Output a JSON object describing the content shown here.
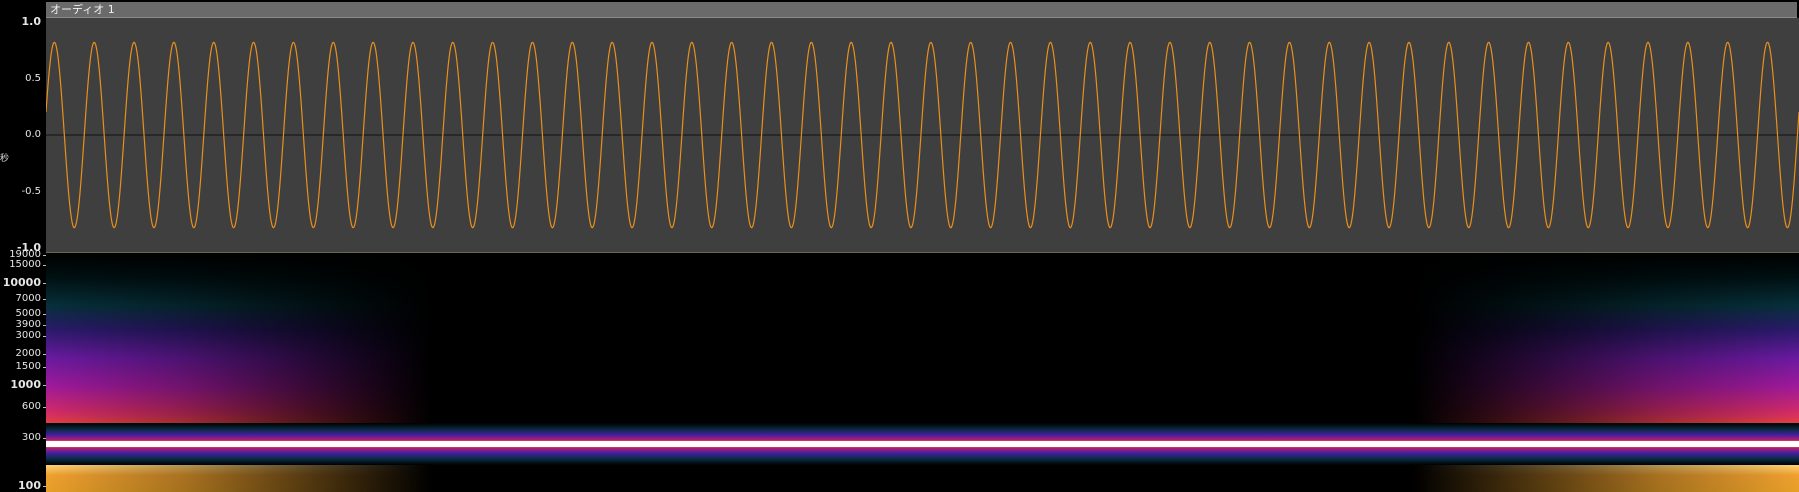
{
  "track": {
    "title": "オーディオ 1",
    "side_marker": "秒"
  },
  "waveform": {
    "amplitude_peak": 0.82,
    "cycles_visible": 44,
    "colors": {
      "wave": "#e8901c",
      "background": "#3f3f3f",
      "zero_line": "#111111"
    },
    "y_labels": [
      {
        "text": "1.0",
        "value": 1.0,
        "bold": true
      },
      {
        "text": "0.5",
        "value": 0.5,
        "bold": false
      },
      {
        "text": "0.0",
        "value": 0.0,
        "bold": false
      },
      {
        "text": "-0.5",
        "value": -0.5,
        "bold": false
      },
      {
        "text": "-1.0",
        "value": -1.0,
        "bold": true
      }
    ]
  },
  "spectrogram": {
    "tone_frequency_hz": 440,
    "y_labels": [
      {
        "text": "19000",
        "value": 19000,
        "bold": false
      },
      {
        "text": "15000",
        "value": 15000,
        "bold": false
      },
      {
        "text": "10000",
        "value": 10000,
        "bold": true
      },
      {
        "text": "7000",
        "value": 7000,
        "bold": false
      },
      {
        "text": "5000",
        "value": 5000,
        "bold": false
      },
      {
        "text": "3900",
        "value": 3900,
        "bold": false
      },
      {
        "text": "3000",
        "value": 3000,
        "bold": false
      },
      {
        "text": "2000",
        "value": 2000,
        "bold": false
      },
      {
        "text": "1500",
        "value": 1500,
        "bold": false
      },
      {
        "text": "1000",
        "value": 1000,
        "bold": true
      },
      {
        "text": "600",
        "value": 600,
        "bold": false
      },
      {
        "text": "300",
        "value": 300,
        "bold": false
      },
      {
        "text": "100",
        "value": 100,
        "bold": true
      }
    ]
  }
}
